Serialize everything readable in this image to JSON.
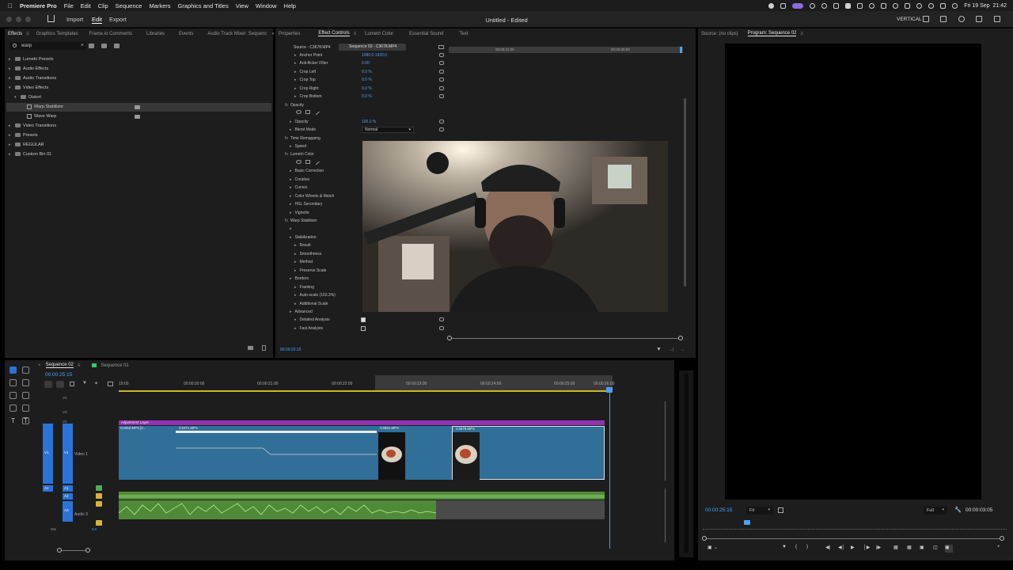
{
  "menubar": {
    "app": "Premiere Pro",
    "items": [
      "File",
      "Edit",
      "Clip",
      "Sequence",
      "Markers",
      "Graphics and Titles",
      "View",
      "Window",
      "Help"
    ],
    "clock": "Fri 19 Sep  21:42"
  },
  "titlebar": {
    "nav": [
      "Import",
      "Edit",
      "Export"
    ],
    "active_nav": "Edit",
    "title": "Untitled - Edited",
    "workspace": "VERTICAL"
  },
  "effects_panel": {
    "tabs": [
      "Effects",
      "Graphics Templates",
      "Frame.io Comments",
      "Libraries",
      "Events",
      "Audio Track Mixer: Sequenc"
    ],
    "search_value": "warp",
    "tree": [
      {
        "label": "Lumetri Presets",
        "depth": 0,
        "expanded": false,
        "kind": "folder"
      },
      {
        "label": "Audio Effects",
        "depth": 0,
        "expanded": false,
        "kind": "folder"
      },
      {
        "label": "Audio Transitions",
        "depth": 0,
        "expanded": false,
        "kind": "folder"
      },
      {
        "label": "Video Effects",
        "depth": 0,
        "expanded": true,
        "kind": "folder"
      },
      {
        "label": "Distort",
        "depth": 1,
        "expanded": true,
        "kind": "folder"
      },
      {
        "label": "Warp Stabilizer",
        "depth": 2,
        "kind": "effect",
        "selected": true
      },
      {
        "label": "Wave Warp",
        "depth": 2,
        "kind": "effect"
      },
      {
        "label": "Video Transitions",
        "depth": 0,
        "expanded": false,
        "kind": "folder"
      },
      {
        "label": "Presets",
        "depth": 0,
        "expanded": false,
        "kind": "folder"
      },
      {
        "label": "REGULAR",
        "depth": 0,
        "expanded": false,
        "kind": "folder"
      },
      {
        "label": "Custom Bin 01",
        "depth": 0,
        "expanded": false,
        "kind": "folder"
      }
    ]
  },
  "effect_controls": {
    "tabs": [
      "Properties",
      "Effect Controls",
      "Lumetri Color",
      "Essential Sound",
      "Text"
    ],
    "active_tab": "Effect Controls",
    "source_label": "Source - C3678.MP4",
    "sequence_label": "Sequence 02 - C3678.MP4",
    "mini_ruler": [
      "00:00:21:00",
      "00:00:25:00"
    ],
    "rows": [
      {
        "label": "Anchor Point",
        "value": "1080.0   1920.0",
        "indent": 2
      },
      {
        "label": "Anti-flicker Filter",
        "value": "0.00",
        "indent": 2
      },
      {
        "label": "Crop Left",
        "value": "0.0 %",
        "indent": 2
      },
      {
        "label": "Crop Top",
        "value": "0.0 %",
        "indent": 2
      },
      {
        "label": "Crop Right",
        "value": "0.0 %",
        "indent": 2
      },
      {
        "label": "Crop Bottom",
        "value": "0.0 %",
        "indent": 2
      },
      {
        "label": "Opacity",
        "value": "",
        "indent": 0,
        "fx": true
      },
      {
        "label": "",
        "value": "",
        "indent": 1,
        "masks": true
      },
      {
        "label": "Opacity",
        "value": "100.0 %",
        "indent": 1
      },
      {
        "label": "Blend Mode",
        "value": "Normal",
        "indent": 1,
        "select": true
      },
      {
        "label": "Time Remapping",
        "value": "",
        "indent": 0,
        "fx": true
      },
      {
        "label": "Speed",
        "value": "",
        "indent": 1
      },
      {
        "label": "Lumetri Color",
        "value": "",
        "indent": 0,
        "fx": true
      },
      {
        "label": "",
        "value": "",
        "indent": 1,
        "masks": true
      },
      {
        "label": "Basic Correction",
        "value": "",
        "indent": 1
      },
      {
        "label": "Creative",
        "value": "",
        "indent": 1
      },
      {
        "label": "Curves",
        "value": "",
        "indent": 1
      },
      {
        "label": "Color Wheels & Match",
        "value": "",
        "indent": 1
      },
      {
        "label": "HSL Secondary",
        "value": "",
        "indent": 1
      },
      {
        "label": "Vignette",
        "value": "",
        "indent": 1
      },
      {
        "label": "Warp Stabilizer",
        "value": "",
        "indent": 0,
        "fx": true
      },
      {
        "label": "",
        "value": "",
        "indent": 1
      },
      {
        "label": "Stabilization",
        "value": "",
        "indent": 1
      },
      {
        "label": "Result",
        "value": "",
        "indent": 2
      },
      {
        "label": "Smoothness",
        "value": "",
        "indent": 2
      },
      {
        "label": "Method",
        "value": "",
        "indent": 2
      },
      {
        "label": "Preserve Scale",
        "value": "",
        "indent": 2
      },
      {
        "label": "Borders",
        "value": "",
        "indent": 1
      },
      {
        "label": "Framing",
        "value": "",
        "indent": 2
      },
      {
        "label": "Auto-scale (103.3%)",
        "value": "",
        "indent": 2
      },
      {
        "label": "Additional Scale",
        "value": "",
        "indent": 2
      },
      {
        "label": "Advanced",
        "value": "",
        "indent": 1
      },
      {
        "label": "Detailed Analysis",
        "value": "",
        "indent": 2,
        "checkbox": true,
        "checked": true
      },
      {
        "label": "Fast Analysis",
        "value": "",
        "indent": 2,
        "checkbox": true,
        "checked": false
      }
    ],
    "timecode": "00:00:25:15"
  },
  "program_monitor": {
    "tabs": [
      "Source: (no clips)",
      "Program: Sequence 02"
    ],
    "timecode": "00:00:25:15",
    "fit": "Fit",
    "quality": "Full",
    "duration": "00:00:03:05"
  },
  "timeline": {
    "tabs": [
      "Sequence 02",
      "Sequence 01"
    ],
    "timecode": "00:00:25:15",
    "ruler": [
      "19:00",
      "00:00:20:00",
      "00:00:21:00",
      "00:00:22:00",
      "00:00:23:00",
      "00:00:24:00",
      "00:00:25:00",
      "00:00:26:00"
    ],
    "video_tracks": [
      "V4",
      "V3",
      "V2",
      "V1"
    ],
    "v1_name": "Video 1",
    "audio_tracks": [
      "A1",
      "A2",
      "A3"
    ],
    "a3_name": "Audio 3",
    "mix_label": "Mix",
    "mix_value": "0.0",
    "source_patch_v": "V1",
    "source_patch_a": "A1",
    "adjustment_label": "Adjustment Layer",
    "clips": [
      "C3452.MP4 [2...",
      "C3471.MP4",
      "C3661.MP4",
      "C3678.MP4"
    ]
  },
  "colors": {
    "accent_blue": "#2b73d6",
    "clip_teal": "#2f6f98",
    "adjustment_purple": "#9033b4",
    "audio_green": "#4f8a38",
    "value_blue": "#4aa0ff"
  }
}
